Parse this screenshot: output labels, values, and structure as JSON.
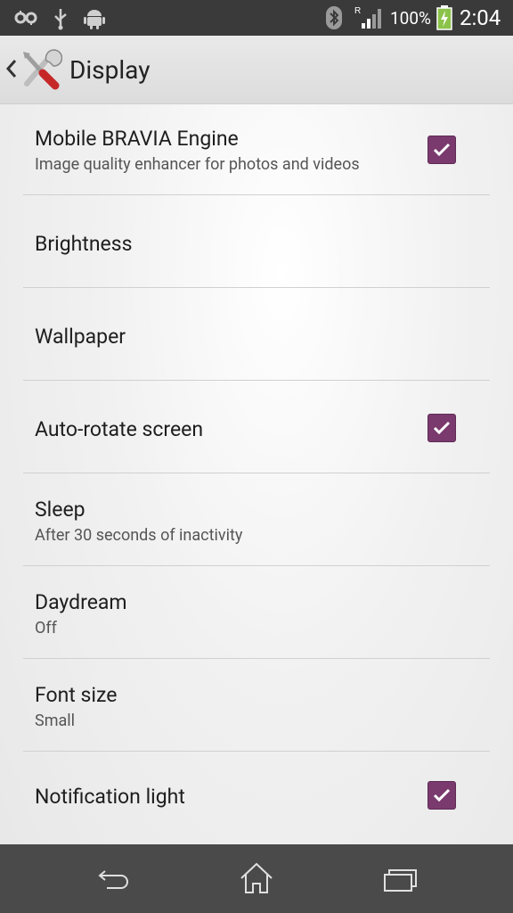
{
  "status_bar": {
    "battery_percent": "100%",
    "time": "2:04",
    "icons": [
      "settings-sync-icon",
      "usb-icon",
      "android-debug-icon",
      "bluetooth-icon",
      "signal-roaming-icon",
      "battery-charging-icon"
    ],
    "roaming_indicator": "R"
  },
  "action_bar": {
    "title": "Display",
    "icon": "settings-tools-icon"
  },
  "settings": [
    {
      "label": "Mobile BRAVIA Engine",
      "summary": "Image quality enhancer for photos and videos",
      "checked": true
    },
    {
      "label": "Brightness",
      "summary": null,
      "checked": null
    },
    {
      "label": "Wallpaper",
      "summary": null,
      "checked": null
    },
    {
      "label": "Auto-rotate screen",
      "summary": null,
      "checked": true
    },
    {
      "label": "Sleep",
      "summary": "After 30 seconds of inactivity",
      "checked": null
    },
    {
      "label": "Daydream",
      "summary": "Off",
      "checked": null
    },
    {
      "label": "Font size",
      "summary": "Small",
      "checked": null
    },
    {
      "label": "Notification light",
      "summary": null,
      "checked": true
    }
  ],
  "nav_bar": {
    "buttons": [
      "back-icon",
      "home-icon",
      "recent-apps-icon"
    ]
  },
  "colors": {
    "checkbox": "#7a3a6e",
    "status_bar": "#3a3a3a",
    "nav_bar": "#4a4a4a"
  }
}
